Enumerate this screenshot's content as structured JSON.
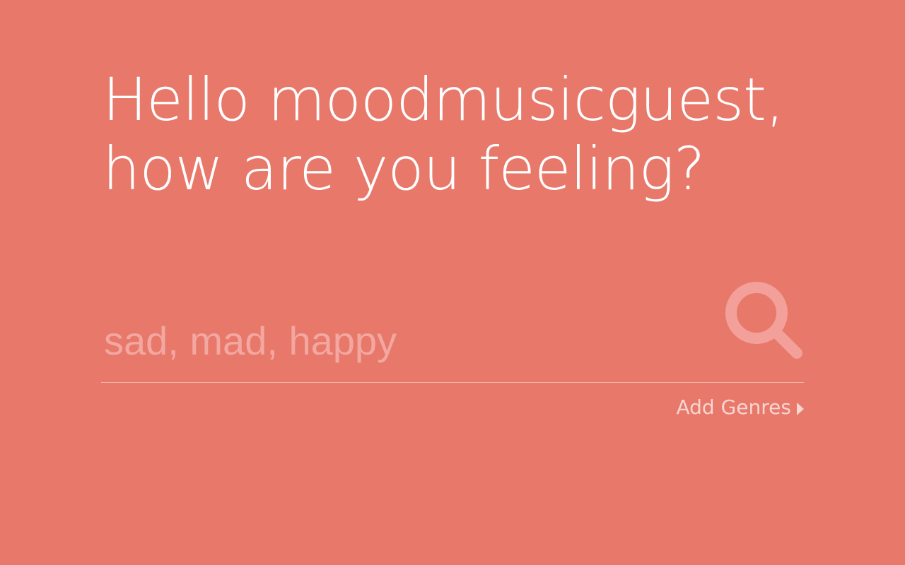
{
  "greeting": {
    "line1": "Hello moodmusicguest,",
    "line2": "how are you feeling?"
  },
  "search": {
    "placeholder": "sad, mad, happy",
    "value": "",
    "icon": "search-icon"
  },
  "add_genres": {
    "label": "Add Genres",
    "icon": "caret-right-icon"
  },
  "colors": {
    "background": "#e8786a",
    "text": "#ffffff",
    "placeholder": "#f3a7a1",
    "search_icon": "#f3a09a",
    "link": "#f7d5d1"
  }
}
